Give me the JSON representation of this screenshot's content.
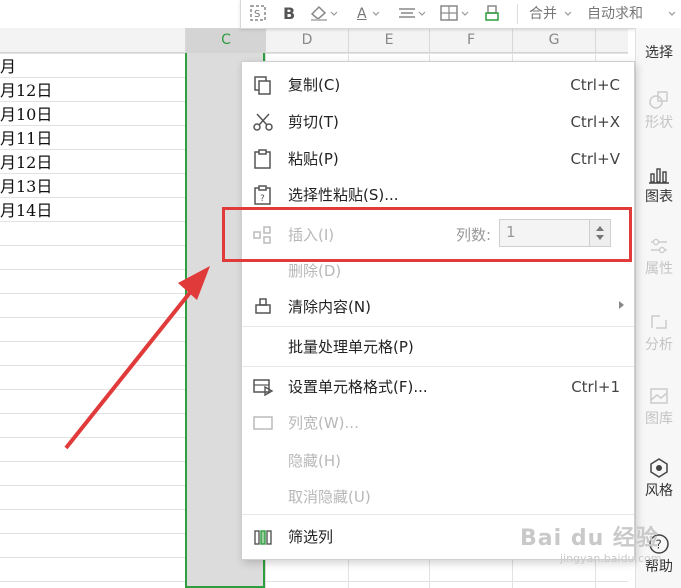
{
  "toolbar": {
    "bold": "B",
    "font_color": "A",
    "merge": "合并",
    "autosum": "自动求和"
  },
  "columns": [
    "C",
    "D",
    "E",
    "F",
    "G"
  ],
  "dates": [
    "月",
    "月12日",
    "月10日",
    "月11日",
    "月12日",
    "月13日",
    "月14日"
  ],
  "menu": {
    "copy": {
      "label": "复制(C)",
      "shortcut": "Ctrl+C"
    },
    "cut": {
      "label": "剪切(T)",
      "shortcut": "Ctrl+X"
    },
    "paste": {
      "label": "粘贴(P)",
      "shortcut": "Ctrl+V"
    },
    "paste_special": {
      "label": "选择性粘贴(S)..."
    },
    "insert": {
      "label": "插入(I)",
      "count_label": "列数:",
      "count_value": "1"
    },
    "delete": {
      "label": "删除(D)"
    },
    "clear": {
      "label": "清除内容(N)"
    },
    "batch": {
      "label": "批量处理单元格(P)"
    },
    "format_cells": {
      "label": "设置单元格格式(F)...",
      "shortcut": "Ctrl+1"
    },
    "col_width": {
      "label": "列宽(W)..."
    },
    "hide": {
      "label": "隐藏(H)"
    },
    "unhide": {
      "label": "取消隐藏(U)"
    },
    "filter_col": {
      "label": "筛选列"
    }
  },
  "sidepanel": {
    "select": "选择",
    "shape": "形状",
    "chart": "图表",
    "attr": "属性",
    "analysis": "分析",
    "gallery": "图库",
    "style": "风格",
    "help": "帮助"
  },
  "watermark": {
    "brand": "Bai du 经验",
    "url": "jingyan.baidu.com"
  },
  "colors": {
    "selection_green": "#2e9e3e",
    "highlight_red": "#e03a3a",
    "arrow_red": "#e03a3a"
  }
}
